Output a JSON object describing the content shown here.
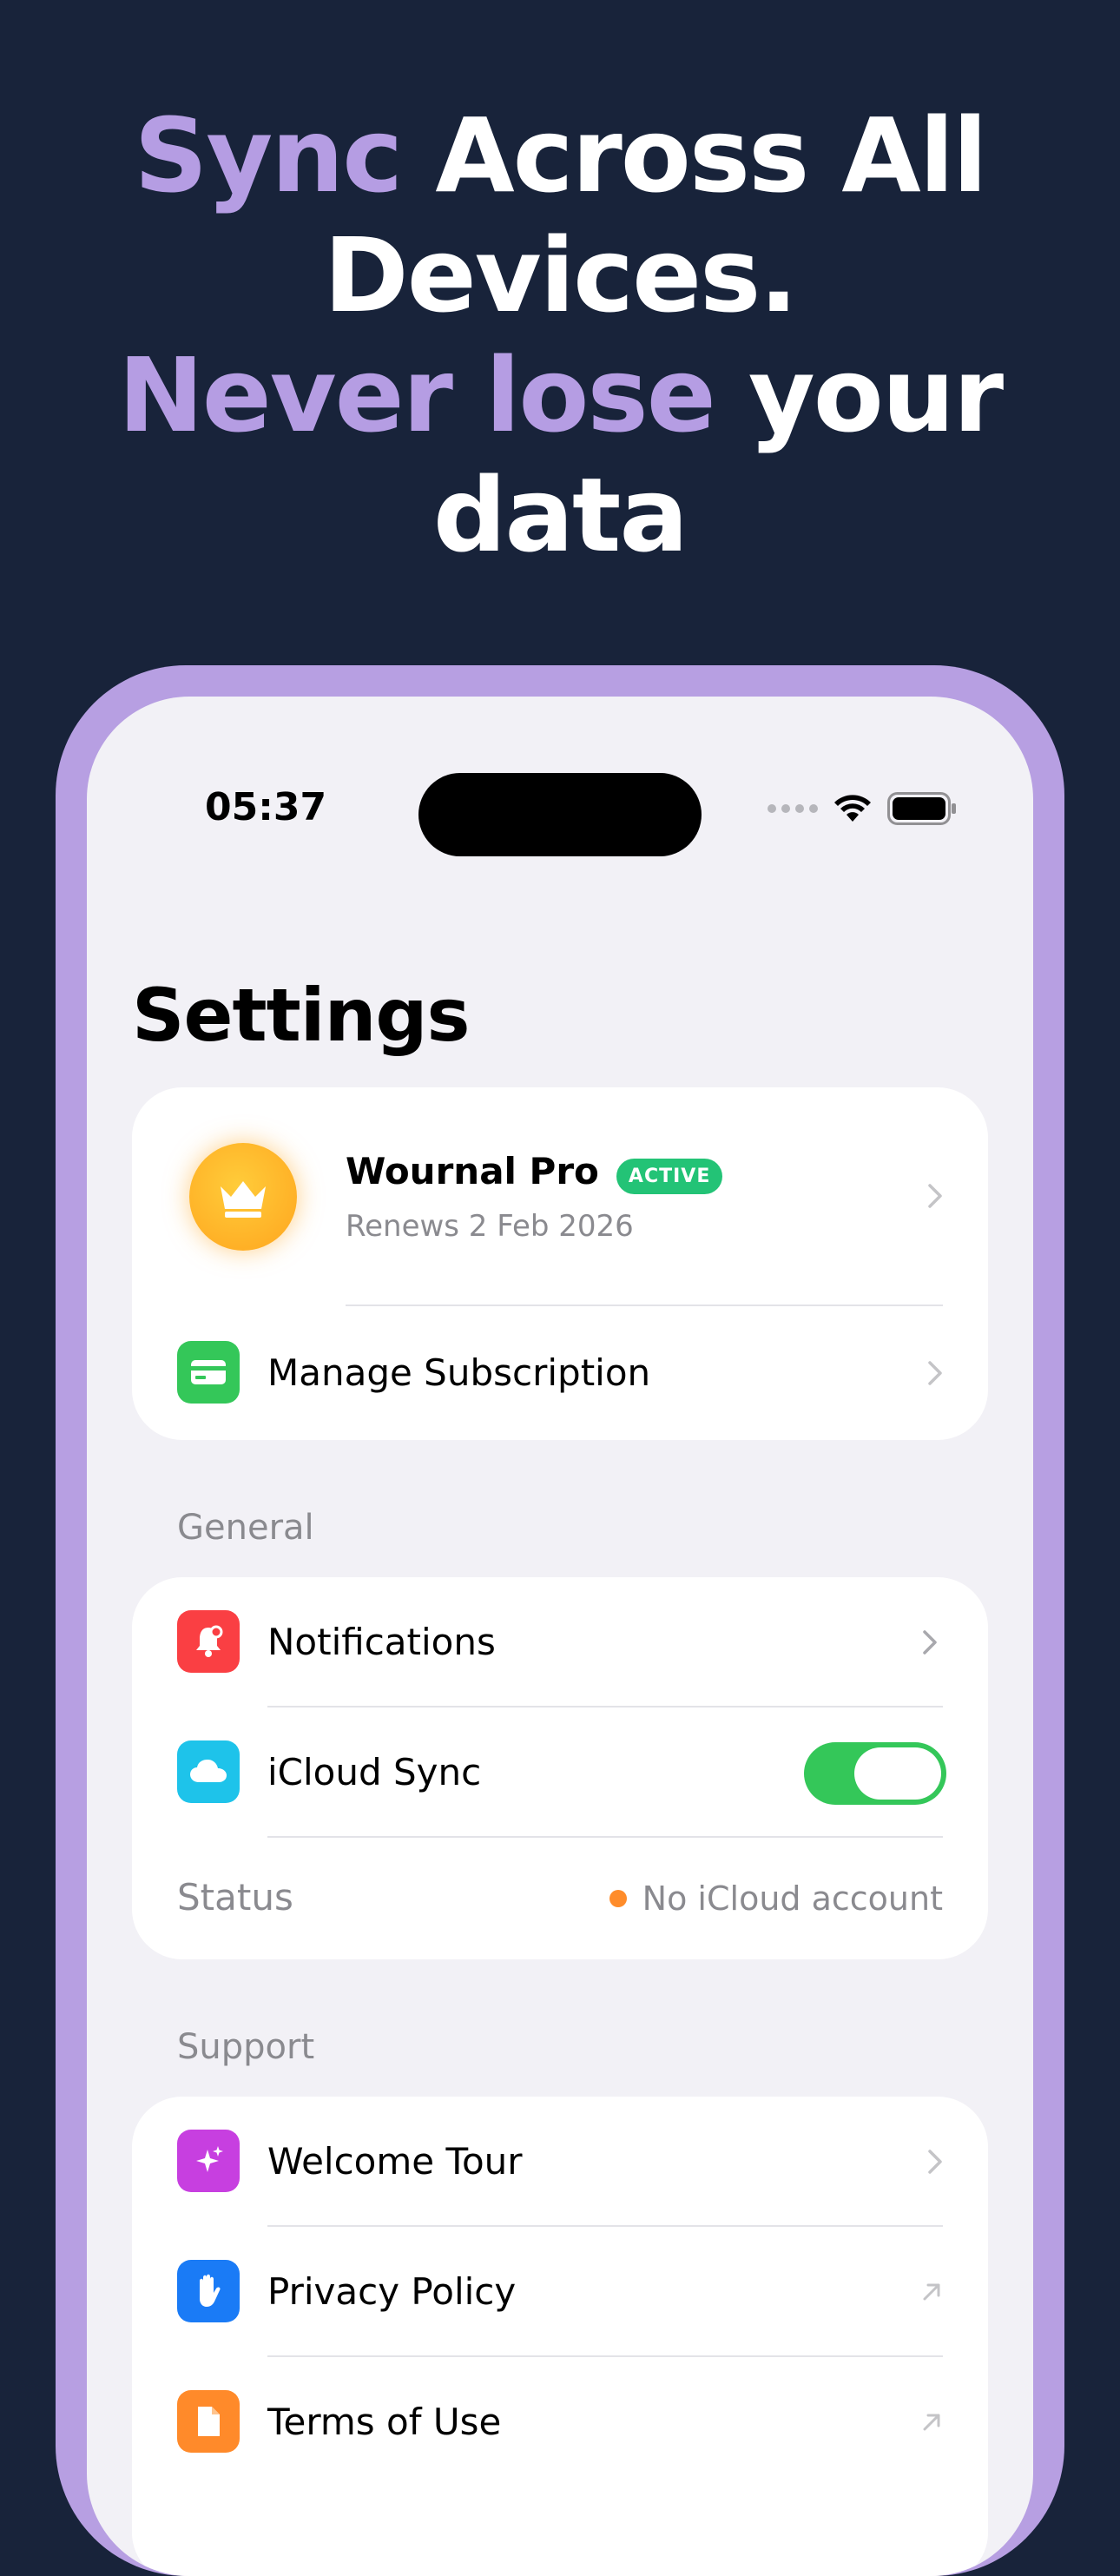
{
  "headline": {
    "line1_accent": "Sync",
    "line1_rest": " Across All",
    "line2": "Devices.",
    "line3_accent": "Never lose",
    "line3_rest": " your",
    "line4": "data"
  },
  "status_bar": {
    "time": "05:37"
  },
  "page": {
    "title": "Settings"
  },
  "subscription": {
    "plan_name": "Wournal Pro",
    "badge": "ACTIVE",
    "renewal": "Renews 2 Feb 2026",
    "manage_label": "Manage Subscription"
  },
  "general": {
    "header": "General",
    "notifications_label": "Notifications",
    "icloud_label": "iCloud Sync",
    "icloud_enabled": true,
    "status_label": "Status",
    "status_value": "No iCloud account"
  },
  "support": {
    "header": "Support",
    "welcome_label": "Welcome Tour",
    "privacy_label": "Privacy Policy",
    "terms_label": "Terms of Use"
  },
  "colors": {
    "background": "#18233a",
    "accent_purple": "#b59de3",
    "toggle_green": "#34c759",
    "badge_green": "#23c376",
    "status_dot": "#ff8c2a"
  }
}
